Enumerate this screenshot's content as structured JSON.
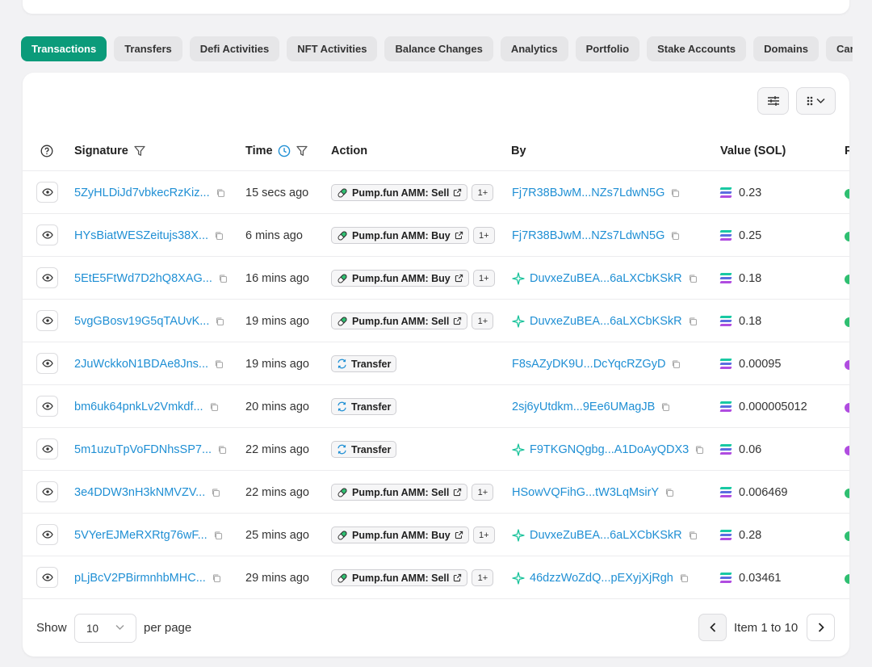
{
  "tabs": [
    {
      "label": "Transactions",
      "active": true
    },
    {
      "label": "Transfers"
    },
    {
      "label": "Defi Activities"
    },
    {
      "label": "NFT Activities"
    },
    {
      "label": "Balance Changes"
    },
    {
      "label": "Analytics"
    },
    {
      "label": "Portfolio"
    },
    {
      "label": "Stake Accounts"
    },
    {
      "label": "Domains"
    },
    {
      "label": "Cards"
    }
  ],
  "columns": {
    "signature": "Signature",
    "time": "Time",
    "action": "Action",
    "by": "By",
    "value": "Value (SOL)",
    "partial": "P"
  },
  "colors": {
    "accent": "#0b9b7a",
    "link": "#1f8fd4",
    "sparkle": "#17c29a",
    "sol_top": "#19c9a3",
    "sol_mid": "#5b6ee0",
    "sol_bot": "#b04ce0"
  },
  "rows": [
    {
      "signature": "5ZyHLDiJd7vbkecRzKiz...",
      "time": "15 secs ago",
      "action": "Pump.fun AMM: Sell",
      "action_icon": "pill-icon",
      "plus": "1+",
      "by": "Fj7R38BJwM...NZs7LdwN5G",
      "by_sparkle": false,
      "value": "0.23"
    },
    {
      "signature": "HYsBiatWESZeitujs38X...",
      "time": "6 mins ago",
      "action": "Pump.fun AMM: Buy",
      "action_icon": "pill-icon",
      "plus": "1+",
      "by": "Fj7R38BJwM...NZs7LdwN5G",
      "by_sparkle": false,
      "value": "0.25"
    },
    {
      "signature": "5EtE5FtWd7D2hQ8XAG...",
      "time": "16 mins ago",
      "action": "Pump.fun AMM: Buy",
      "action_icon": "pill-icon",
      "plus": "1+",
      "by": "DuvxeZuBEA...6aLXCbKSkR",
      "by_sparkle": true,
      "value": "0.18"
    },
    {
      "signature": "5vgGBosv19G5qTAUvK...",
      "time": "19 mins ago",
      "action": "Pump.fun AMM: Sell",
      "action_icon": "pill-icon",
      "plus": "1+",
      "by": "DuvxeZuBEA...6aLXCbKSkR",
      "by_sparkle": true,
      "value": "0.18"
    },
    {
      "signature": "2JuWckkoN1BDAe8Jns...",
      "time": "19 mins ago",
      "action": "Transfer",
      "action_icon": "transfer-icon",
      "plus": "",
      "by": "F8sAZyDK9U...DcYqcRZGyD",
      "by_sparkle": false,
      "value": "0.00095"
    },
    {
      "signature": "bm6uk64pnkLv2Vmkdf...",
      "time": "20 mins ago",
      "action": "Transfer",
      "action_icon": "transfer-icon",
      "plus": "",
      "by": "2sj6yUtdkm...9Ee6UMagJB",
      "by_sparkle": false,
      "value": "0.000005012"
    },
    {
      "signature": "5m1uzuTpVoFDNhsSP7...",
      "time": "22 mins ago",
      "action": "Transfer",
      "action_icon": "transfer-icon",
      "plus": "",
      "by": "F9TKGNQgbg...A1DoAyQDX3",
      "by_sparkle": true,
      "value": "0.06"
    },
    {
      "signature": "3e4DDW3nH3kNMVZV...",
      "time": "22 mins ago",
      "action": "Pump.fun AMM: Sell",
      "action_icon": "pill-icon",
      "plus": "1+",
      "by": "HSowVQFihG...tW3LqMsirY",
      "by_sparkle": false,
      "value": "0.006469"
    },
    {
      "signature": "5VYerEJMeRXRtg76wF...",
      "time": "25 mins ago",
      "action": "Pump.fun AMM: Buy",
      "action_icon": "pill-icon",
      "plus": "1+",
      "by": "DuvxeZuBEA...6aLXCbKSkR",
      "by_sparkle": true,
      "value": "0.28"
    },
    {
      "signature": "pLjBcV2PBirmnhbMHC...",
      "time": "29 mins ago",
      "action": "Pump.fun AMM: Sell",
      "action_icon": "pill-icon",
      "plus": "1+",
      "by": "46dzzWoZdQ...pEXyjXjRgh",
      "by_sparkle": true,
      "value": "0.03461"
    }
  ],
  "footer": {
    "show_label": "Show",
    "per_page_value": "10",
    "per_page_label": "per page",
    "range_text": "Item 1 to 10"
  }
}
